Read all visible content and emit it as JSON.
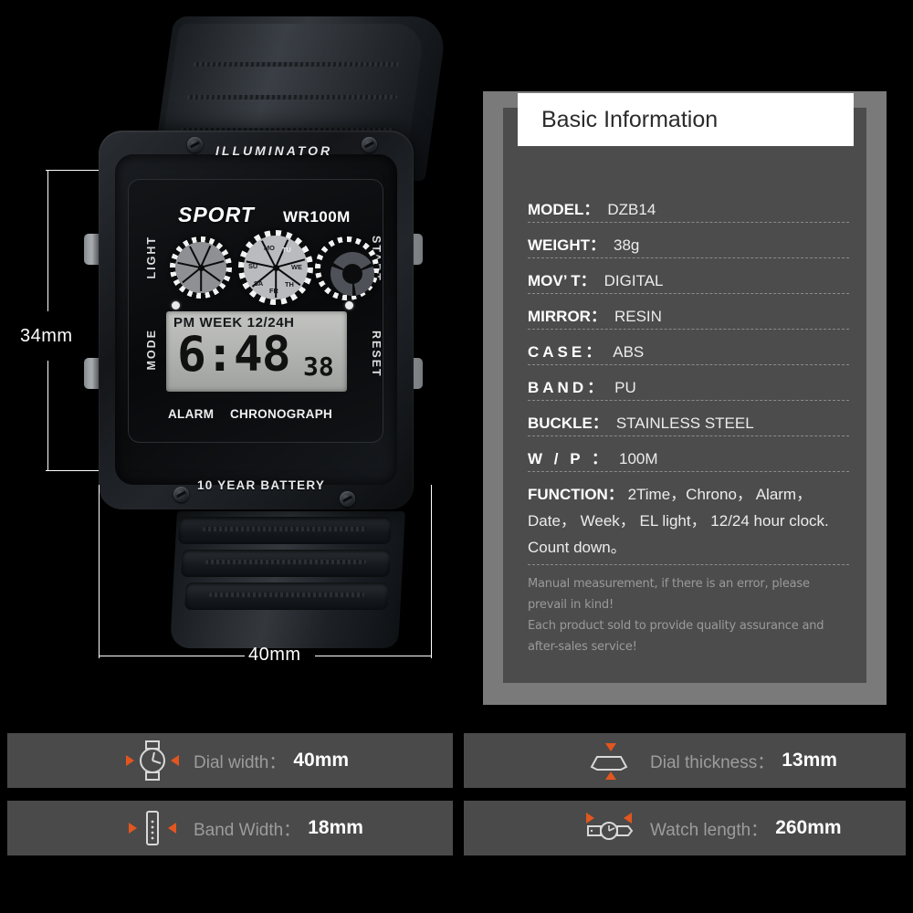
{
  "watch": {
    "bezel_top_text": "ILLUMINATOR",
    "bezel_bottom_text": "10 YEAR BATTERY",
    "dial_brand": "SPORT",
    "dial_water_rating": "WR100M",
    "button_light": "LIGHT",
    "button_start": "START",
    "button_mode": "MODE",
    "button_reset": "RESET",
    "lcd": {
      "indicators": "PM  WEEK  12/24H",
      "time": "6:48",
      "seconds": "38"
    },
    "dial_alarm": "ALARM",
    "dial_chronograph": "CHRONOGRAPH",
    "weekday_labels": [
      "MO",
      "TU",
      "WE",
      "TH",
      "FR",
      "SA",
      "SU"
    ],
    "dimensions": {
      "height": "34mm",
      "width": "40mm"
    }
  },
  "panel": {
    "title": "Basic Information",
    "specs": [
      {
        "label": "MODEL：",
        "value": "DZB14",
        "spaced": false
      },
      {
        "label": "WEIGHT：",
        "value": "38g",
        "spaced": false
      },
      {
        "label": "MOV’ T：",
        "value": "DIGITAL",
        "spaced": false
      },
      {
        "label": "MIRROR：",
        "value": "RESIN",
        "spaced": false
      },
      {
        "label": "CASE：",
        "value": "ABS",
        "spaced": true
      },
      {
        "label": "BAND：",
        "value": "PU",
        "spaced": true
      },
      {
        "label": "BUCKLE：",
        "value": "STAINLESS STEEL",
        "spaced": false
      },
      {
        "label": "W / P ：",
        "value": "100M",
        "spaced": true
      }
    ],
    "function": {
      "label": "FUNCTION：",
      "line1": "2Time，Chrono， Alarm，",
      "line2": "Date， Week， EL light， 12/24 hour clock.",
      "line3": "Count down。"
    },
    "notes": [
      "Manual measurement, if there is an error, please prevail in kind!",
      "Each product sold to provide quality assurance and after-sales service!"
    ]
  },
  "feature_cards": [
    {
      "icon": "watch-front-icon",
      "label": "Dial width：",
      "value": "40mm"
    },
    {
      "icon": "watch-side-icon",
      "label": "Dial thickness：",
      "value": "13mm"
    },
    {
      "icon": "watch-band-icon",
      "label": "Band Width：",
      "value": "18mm"
    },
    {
      "icon": "watch-length-icon",
      "label": "Watch length：",
      "value": "260mm"
    }
  ],
  "colors": {
    "background": "#000000",
    "panel_frame": "#7a7a7a",
    "panel_card": "#4c4c4c",
    "card": "#4a4a4a",
    "accent_orange": "#e2561f",
    "title_bar": "#ffffff"
  }
}
